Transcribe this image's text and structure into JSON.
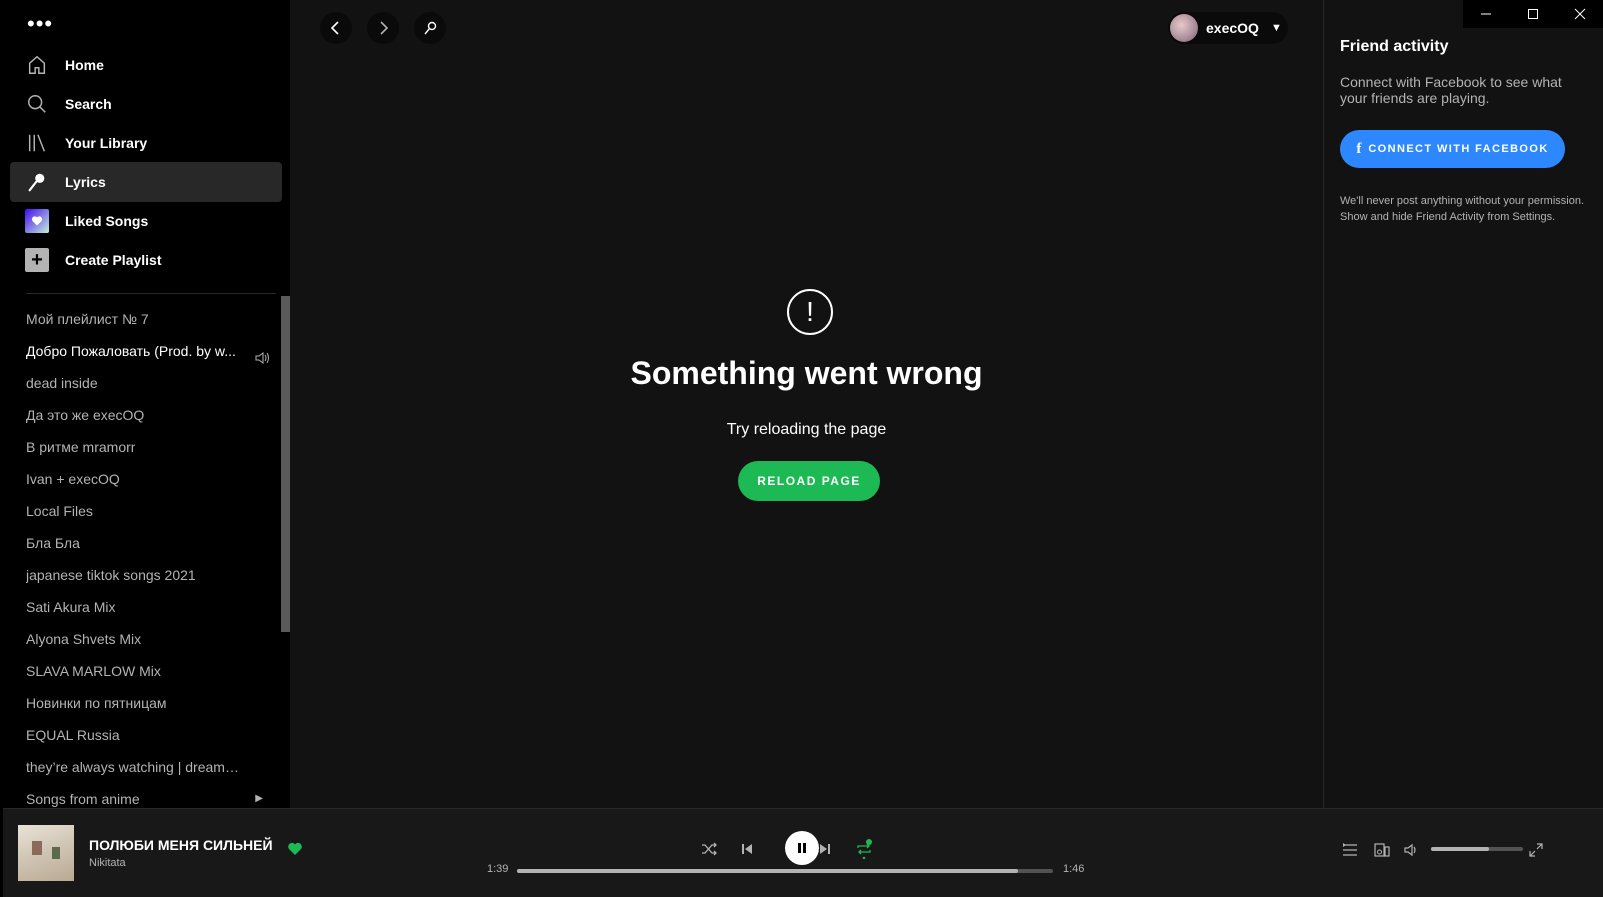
{
  "sidebar": {
    "menu_dots": "•••",
    "nav": [
      {
        "label": "Home"
      },
      {
        "label": "Search"
      },
      {
        "label": "Your Library"
      },
      {
        "label": "Lyrics"
      },
      {
        "label": "Liked Songs"
      },
      {
        "label": "Create Playlist"
      }
    ],
    "playlists": [
      "Мой плейлист № 7",
      "Добро Пожаловать (Prod. by w...",
      "dead inside",
      "Да это же execOQ",
      "В ритме mramorr",
      "Ivan + execOQ",
      "Local Files",
      "Бла Бла",
      "japanese tiktok songs 2021",
      "Sati Akura Mix",
      "Alyona Shvets Mix",
      "SLAVA MARLOW Mix",
      "Новинки по пятницам",
      "EQUAL Russia",
      "they’re always watching | dreamcore...",
      "Songs from anime"
    ]
  },
  "header": {
    "username": "execOQ"
  },
  "error": {
    "icon": "!",
    "title": "Something went wrong",
    "subtitle": "Try reloading the page",
    "reload_label": "RELOAD PAGE"
  },
  "friends": {
    "title": "Friend activity",
    "text": "Connect with Facebook to see what your friends are playing.",
    "button_label": "CONNECT WITH FACEBOOK",
    "button_icon": "f",
    "note": "We'll never post anything without your permission. Show and hide Friend Activity from Settings."
  },
  "player": {
    "title": "ПОЛЮБИ МЕНЯ СИЛЬНЕЙ",
    "artist": "Nikitata",
    "time_current": "1:39",
    "time_total": "1:46",
    "progress_fraction": 0.934,
    "volume_fraction": 0.63,
    "liked": true
  },
  "colors": {
    "accent": "#1db954",
    "facebook": "#2d88ff",
    "background": "#121212"
  }
}
